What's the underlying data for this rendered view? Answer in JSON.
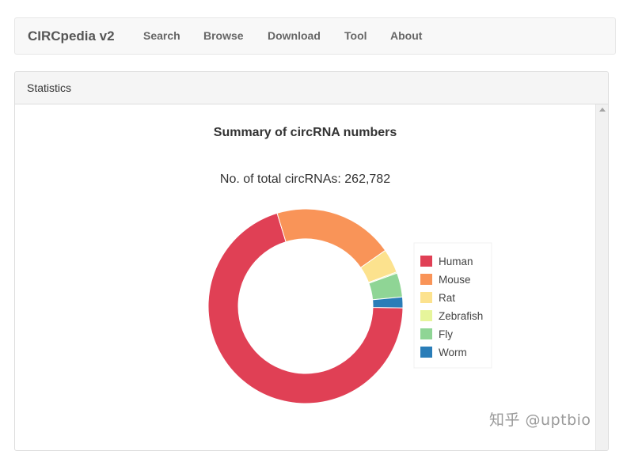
{
  "navbar": {
    "brand": "CIRCpedia v2",
    "links": [
      "Search",
      "Browse",
      "Download",
      "Tool",
      "About"
    ]
  },
  "panel": {
    "title": "Statistics"
  },
  "chart_data": {
    "type": "pie",
    "donut": true,
    "title": "Summary of circRNA numbers",
    "subtitle": "No. of total circRNAs: 262,782",
    "legend_position": "right",
    "categories": [
      "Human",
      "Mouse",
      "Rat",
      "Zebrafish",
      "Fly",
      "Worm"
    ],
    "values": [
      183943,
      52556,
      10511,
      526,
      10511,
      4735
    ],
    "colors": [
      "#e04055",
      "#f99458",
      "#fce28e",
      "#e6f59b",
      "#8fd595",
      "#2a7db8"
    ]
  },
  "watermark": "知乎 @uptbio"
}
